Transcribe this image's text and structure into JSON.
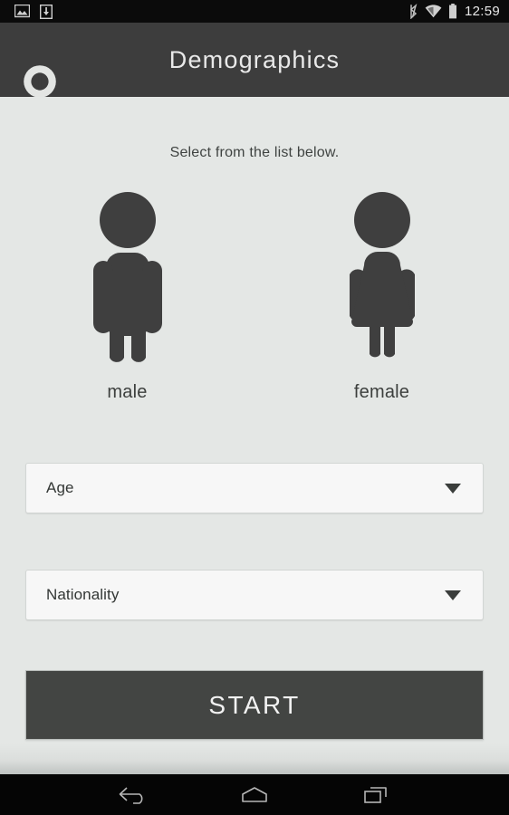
{
  "statusbar": {
    "time": "12:59",
    "left_icons": [
      "screenshot-image-icon",
      "download-icon"
    ],
    "right_icons": [
      "bluetooth-icon",
      "wifi-icon",
      "battery-icon"
    ]
  },
  "header": {
    "title": "Demographics",
    "logo_icon": "app-logo-icon",
    "background_color": "#3d3d3d",
    "title_color": "#e9e9e9"
  },
  "main": {
    "prompt": "Select from the list below.",
    "background_color": "#e4e7e5",
    "genders": [
      {
        "label": "male",
        "icon": "male-figure-icon"
      },
      {
        "label": "female",
        "icon": "female-figure-icon"
      }
    ],
    "fields": [
      {
        "value": "Age",
        "caret_icon": "chevron-down-icon"
      },
      {
        "value": "Nationality",
        "caret_icon": "chevron-down-icon"
      }
    ],
    "start_button": {
      "label": "START",
      "background_color": "#434543",
      "text_color": "#f2f2f2"
    }
  },
  "navbar": {
    "back_icon": "back-arrow-icon",
    "home_icon": "home-icon",
    "recents_icon": "recent-apps-icon"
  }
}
